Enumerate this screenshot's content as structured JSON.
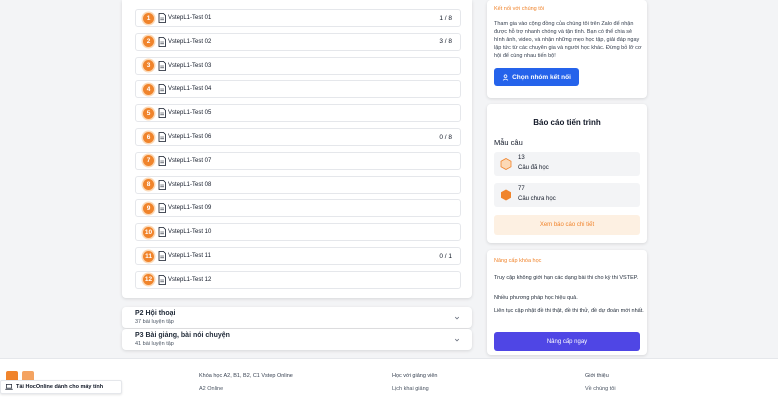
{
  "tests": [
    {
      "num": "1",
      "name": "VstepL1-Test 01",
      "score": "1 / 8"
    },
    {
      "num": "2",
      "name": "VstepL1-Test 02",
      "score": "3 / 8"
    },
    {
      "num": "3",
      "name": "VstepL1-Test 03",
      "score": ""
    },
    {
      "num": "4",
      "name": "VstepL1-Test 04",
      "score": ""
    },
    {
      "num": "5",
      "name": "VstepL1-Test 05",
      "score": ""
    },
    {
      "num": "6",
      "name": "VstepL1-Test 06",
      "score": "0 / 8"
    },
    {
      "num": "7",
      "name": "VstepL1-Test 07",
      "score": ""
    },
    {
      "num": "8",
      "name": "VstepL1-Test 08",
      "score": ""
    },
    {
      "num": "9",
      "name": "VstepL1-Test 09",
      "score": ""
    },
    {
      "num": "10",
      "name": "VstepL1-Test 10",
      "score": ""
    },
    {
      "num": "11",
      "name": "VstepL1-Test 11",
      "score": "0 / 1"
    },
    {
      "num": "12",
      "name": "VstepL1-Test 12",
      "score": ""
    }
  ],
  "sections": [
    {
      "title": "P2 Hội thoại",
      "sub": "37 bài luyện tập"
    },
    {
      "title": "P3 Bài giảng, bài nói chuyện",
      "sub": "41 bài luyện tập"
    }
  ],
  "connect": {
    "title": "Kết nối với chúng tôi",
    "desc": "Tham gia vào cộng đồng của chúng tôi trên Zalo để nhận được hỗ trợ nhanh chóng và tận tình. Bạn có thể chia sẻ hình ảnh, video, và nhận những mẹo học tập, giải đáp ngay lập tức từ các chuyên gia và người học khác. Đừng bỏ lỡ cơ hội để cùng nhau tiến bộ!",
    "button": "Chọn nhóm kết nối"
  },
  "report": {
    "title": "Báo cáo tiến trình",
    "subtitle": "Mẫu câu",
    "learned_count": "13",
    "learned_label": "Câu đã học",
    "unlearned_count": "77",
    "unlearned_label": "Câu chưa học",
    "button": "Xem báo cáo chi tiết"
  },
  "upgrade": {
    "title": "Nâng cấp khóa học",
    "p1": "Truy cập không giới hạn các dạng bài thi cho kỳ thi VSTEP.",
    "p2": "Nhiều phương pháp học hiệu quả.",
    "p3": "Liên tục cập nhật đề thi thật, đề thi thử, đề dự đoán mới nhất.",
    "button": "Nâng cấp ngay"
  },
  "footer": {
    "col1_heading": "Khóa học A2, B1, B2, C1 Vstep Online",
    "col1_link": "A2 Online",
    "col2_heading": "Học với giảng viên",
    "col2_link": "Lịch khai giảng",
    "col3_heading": "Giới thiệu",
    "col3_link": "Về chúng tôi",
    "download": "Tải HocOnline dành cho máy tính"
  },
  "colors": {
    "accent_orange": "#f0842c",
    "primary_blue": "#2563eb",
    "upgrade_indigo": "#4f46e5"
  }
}
